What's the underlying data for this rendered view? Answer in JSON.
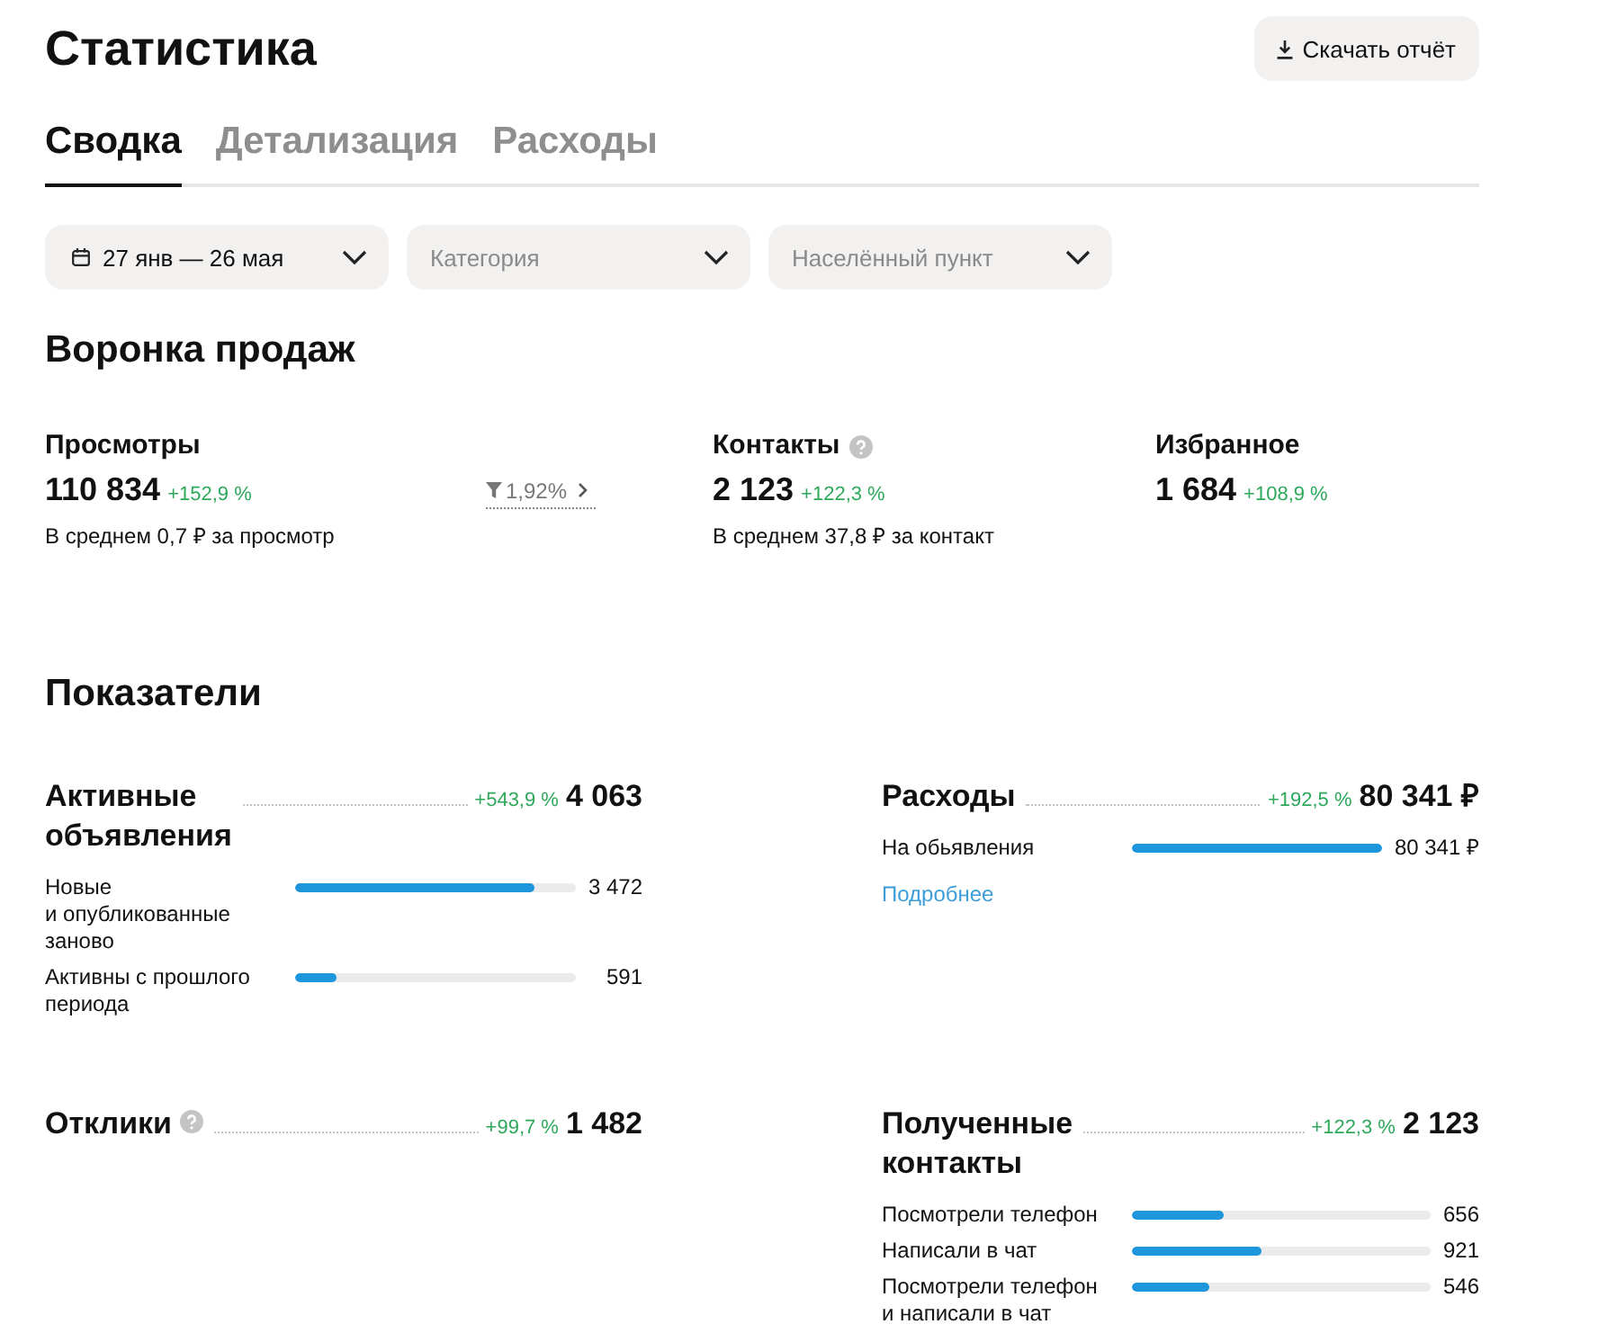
{
  "header": {
    "title": "Статистика",
    "download_button": "Скачать отчёт"
  },
  "tabs": [
    {
      "label": "Сводка",
      "selected": true
    },
    {
      "label": "Детализация",
      "selected": false
    },
    {
      "label": "Расходы",
      "selected": false
    }
  ],
  "filters": [
    {
      "kind": "date",
      "value": "27 янв — 26 мая"
    },
    {
      "kind": "select",
      "placeholder": "Категория"
    },
    {
      "kind": "select",
      "placeholder": "Населённый пункт"
    }
  ],
  "funnel": {
    "title": "Воронка продаж",
    "items": [
      {
        "kind": "metric",
        "label": "Просмотры",
        "help": false,
        "value": "110 834",
        "change": "+152,9 %",
        "note": "В среднем 0,7 ₽ за просмотр"
      },
      {
        "kind": "conversion",
        "value": "1,92%"
      },
      {
        "kind": "metric",
        "label": "Контакты",
        "help": true,
        "value": "2 123",
        "change": "+122,3 %",
        "note": "В среднем 37,8 ₽ за контакт"
      },
      {
        "kind": "metric",
        "label": "Избранное",
        "help": false,
        "value": "1 684",
        "change": "+108,9 %"
      }
    ]
  },
  "indicators": {
    "title": "Показатели",
    "blocks": [
      {
        "title": "Активные объявления",
        "help": false,
        "change": "+543,9 %",
        "value": "4 063",
        "rows": [
          {
            "label": "Новые и опубликованные заново",
            "level": 0.855,
            "value": "3 472"
          },
          {
            "label": "Активны с прошлого периода",
            "level": 0.146,
            "value": "591"
          }
        ]
      },
      {
        "title": "Расходы",
        "help": false,
        "change": "+192,5 %",
        "value": "80 341 ₽",
        "rows": [
          {
            "label": "На обьявления",
            "level": 1,
            "value": "80 341 ₽"
          }
        ],
        "link": "Подробнее"
      },
      {
        "title": "Отклики",
        "help": true,
        "change": "+99,7 %",
        "value": "1 482"
      },
      {
        "title": "Полученные контакты",
        "help": false,
        "change": "+122,3 %",
        "value": "2 123",
        "rows": [
          {
            "label": "Посмотрели телефон",
            "level": 0.309,
            "value": "656"
          },
          {
            "label": "Написали в чат",
            "level": 0.434,
            "value": "921"
          },
          {
            "label": "Посмотрели телефон и написали в чат",
            "level": 0.257,
            "value": "546"
          }
        ]
      }
    ]
  }
}
